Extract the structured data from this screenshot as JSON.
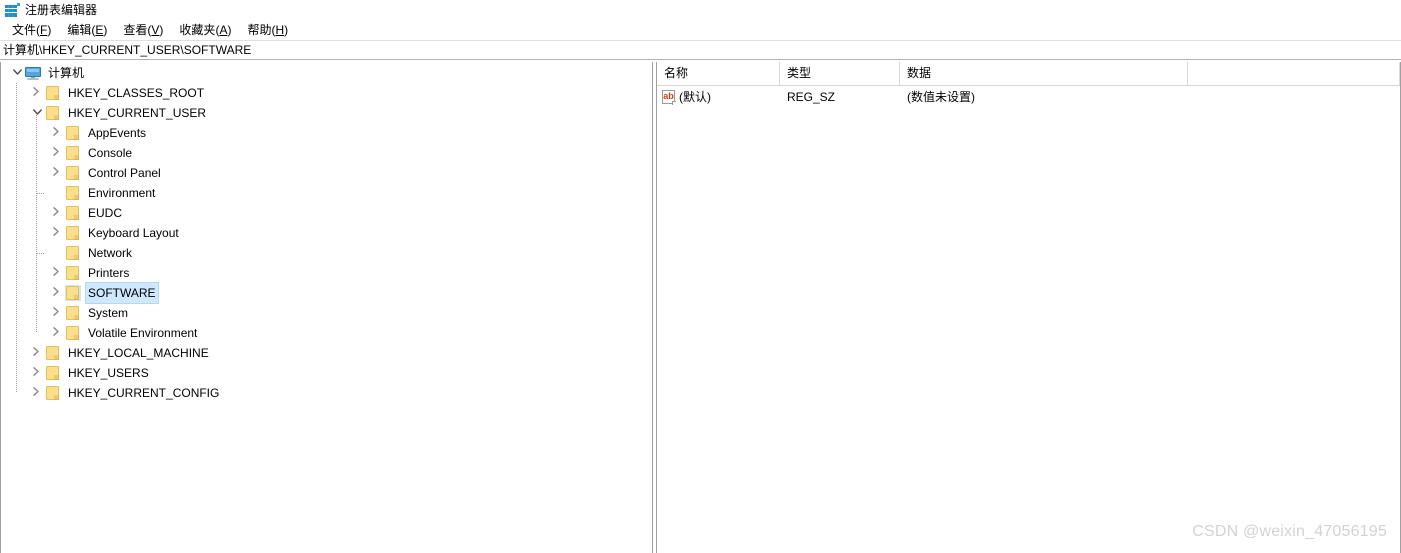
{
  "window": {
    "title": "注册表编辑器",
    "icon": "registry-editor-icon"
  },
  "menubar": {
    "items": [
      {
        "label": "文件",
        "accel": "F"
      },
      {
        "label": "编辑",
        "accel": "E"
      },
      {
        "label": "查看",
        "accel": "V"
      },
      {
        "label": "收藏夹",
        "accel": "A"
      },
      {
        "label": "帮助",
        "accel": "H"
      }
    ]
  },
  "address": {
    "path": "计算机\\HKEY_CURRENT_USER\\SOFTWARE"
  },
  "tree": {
    "nodes": [
      {
        "label": "计算机",
        "depth": 0,
        "icon": "computer-icon",
        "state": "expanded",
        "selected": false
      },
      {
        "label": "HKEY_CLASSES_ROOT",
        "depth": 1,
        "icon": "folder-icon",
        "state": "collapsed",
        "selected": false
      },
      {
        "label": "HKEY_CURRENT_USER",
        "depth": 1,
        "icon": "folder-icon",
        "state": "expanded",
        "selected": false
      },
      {
        "label": "AppEvents",
        "depth": 2,
        "icon": "folder-icon",
        "state": "collapsed",
        "selected": false
      },
      {
        "label": "Console",
        "depth": 2,
        "icon": "folder-icon",
        "state": "collapsed",
        "selected": false
      },
      {
        "label": "Control Panel",
        "depth": 2,
        "icon": "folder-icon",
        "state": "collapsed",
        "selected": false
      },
      {
        "label": "Environment",
        "depth": 2,
        "icon": "folder-icon",
        "state": "leaf",
        "selected": false
      },
      {
        "label": "EUDC",
        "depth": 2,
        "icon": "folder-icon",
        "state": "collapsed",
        "selected": false
      },
      {
        "label": "Keyboard Layout",
        "depth": 2,
        "icon": "folder-icon",
        "state": "collapsed",
        "selected": false
      },
      {
        "label": "Network",
        "depth": 2,
        "icon": "folder-icon",
        "state": "leaf",
        "selected": false
      },
      {
        "label": "Printers",
        "depth": 2,
        "icon": "folder-icon",
        "state": "collapsed",
        "selected": false
      },
      {
        "label": "SOFTWARE",
        "depth": 2,
        "icon": "folder-icon",
        "state": "collapsed",
        "selected": true
      },
      {
        "label": "System",
        "depth": 2,
        "icon": "folder-icon",
        "state": "collapsed",
        "selected": false
      },
      {
        "label": "Volatile Environment",
        "depth": 2,
        "icon": "folder-icon",
        "state": "collapsed",
        "selected": false
      },
      {
        "label": "HKEY_LOCAL_MACHINE",
        "depth": 1,
        "icon": "folder-icon",
        "state": "collapsed",
        "selected": false
      },
      {
        "label": "HKEY_USERS",
        "depth": 1,
        "icon": "folder-icon",
        "state": "collapsed",
        "selected": false
      },
      {
        "label": "HKEY_CURRENT_CONFIG",
        "depth": 1,
        "icon": "folder-icon",
        "state": "collapsed",
        "selected": false
      }
    ]
  },
  "list": {
    "columns": [
      {
        "label": "名称"
      },
      {
        "label": "类型"
      },
      {
        "label": "数据"
      }
    ],
    "rows": [
      {
        "icon": "string-value-icon",
        "name": "(默认)",
        "type": "REG_SZ",
        "data": "(数值未设置)"
      }
    ]
  },
  "watermark": {
    "text": "CSDN @weixin_47056195"
  },
  "colors": {
    "selection": "#cde8ff",
    "selection_border": "#b5d9f5",
    "folder": "#fcdf8a",
    "accent": "#29a3e3",
    "watermark": "#d2d2d2"
  }
}
